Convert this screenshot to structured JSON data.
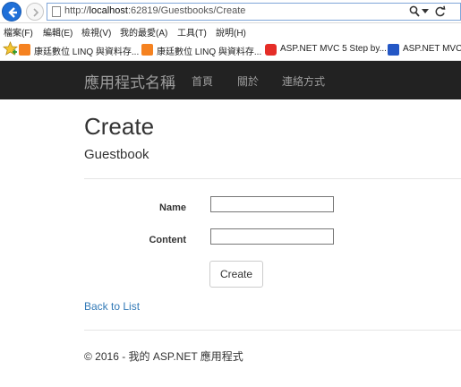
{
  "browser": {
    "url_prefix": "http://",
    "url_host": "localhost",
    "url_rest": ":62819/Guestbooks/Create",
    "menu": [
      "檔案(F)",
      "編輯(E)",
      "檢視(V)",
      "我的最愛(A)",
      "工具(T)",
      "說明(H)"
    ],
    "favorites": [
      {
        "label": "康廷數位 LINQ 與資料存...",
        "icon_color": "#f58220"
      },
      {
        "label": "康廷數位 LINQ 與資料存...",
        "icon_color": "#f58220"
      },
      {
        "label": "ASP.NET MVC 5 Step by...",
        "icon_color": "#e52d27"
      },
      {
        "label": "ASP.NET MVC",
        "icon_color": "#2457c5"
      }
    ]
  },
  "navbar": {
    "brand": "應用程式名稱",
    "links": [
      "首頁",
      "關於",
      "連絡方式"
    ]
  },
  "page": {
    "title": "Create",
    "subtitle": "Guestbook"
  },
  "form": {
    "name_label": "Name",
    "name_value": "",
    "content_label": "Content",
    "content_value": "",
    "submit_label": "Create"
  },
  "back_link": "Back to List",
  "footer": "© 2016 - 我的 ASP.NET 應用程式",
  "colors": {
    "navbar_bg": "#222222",
    "link": "#337ab7"
  }
}
